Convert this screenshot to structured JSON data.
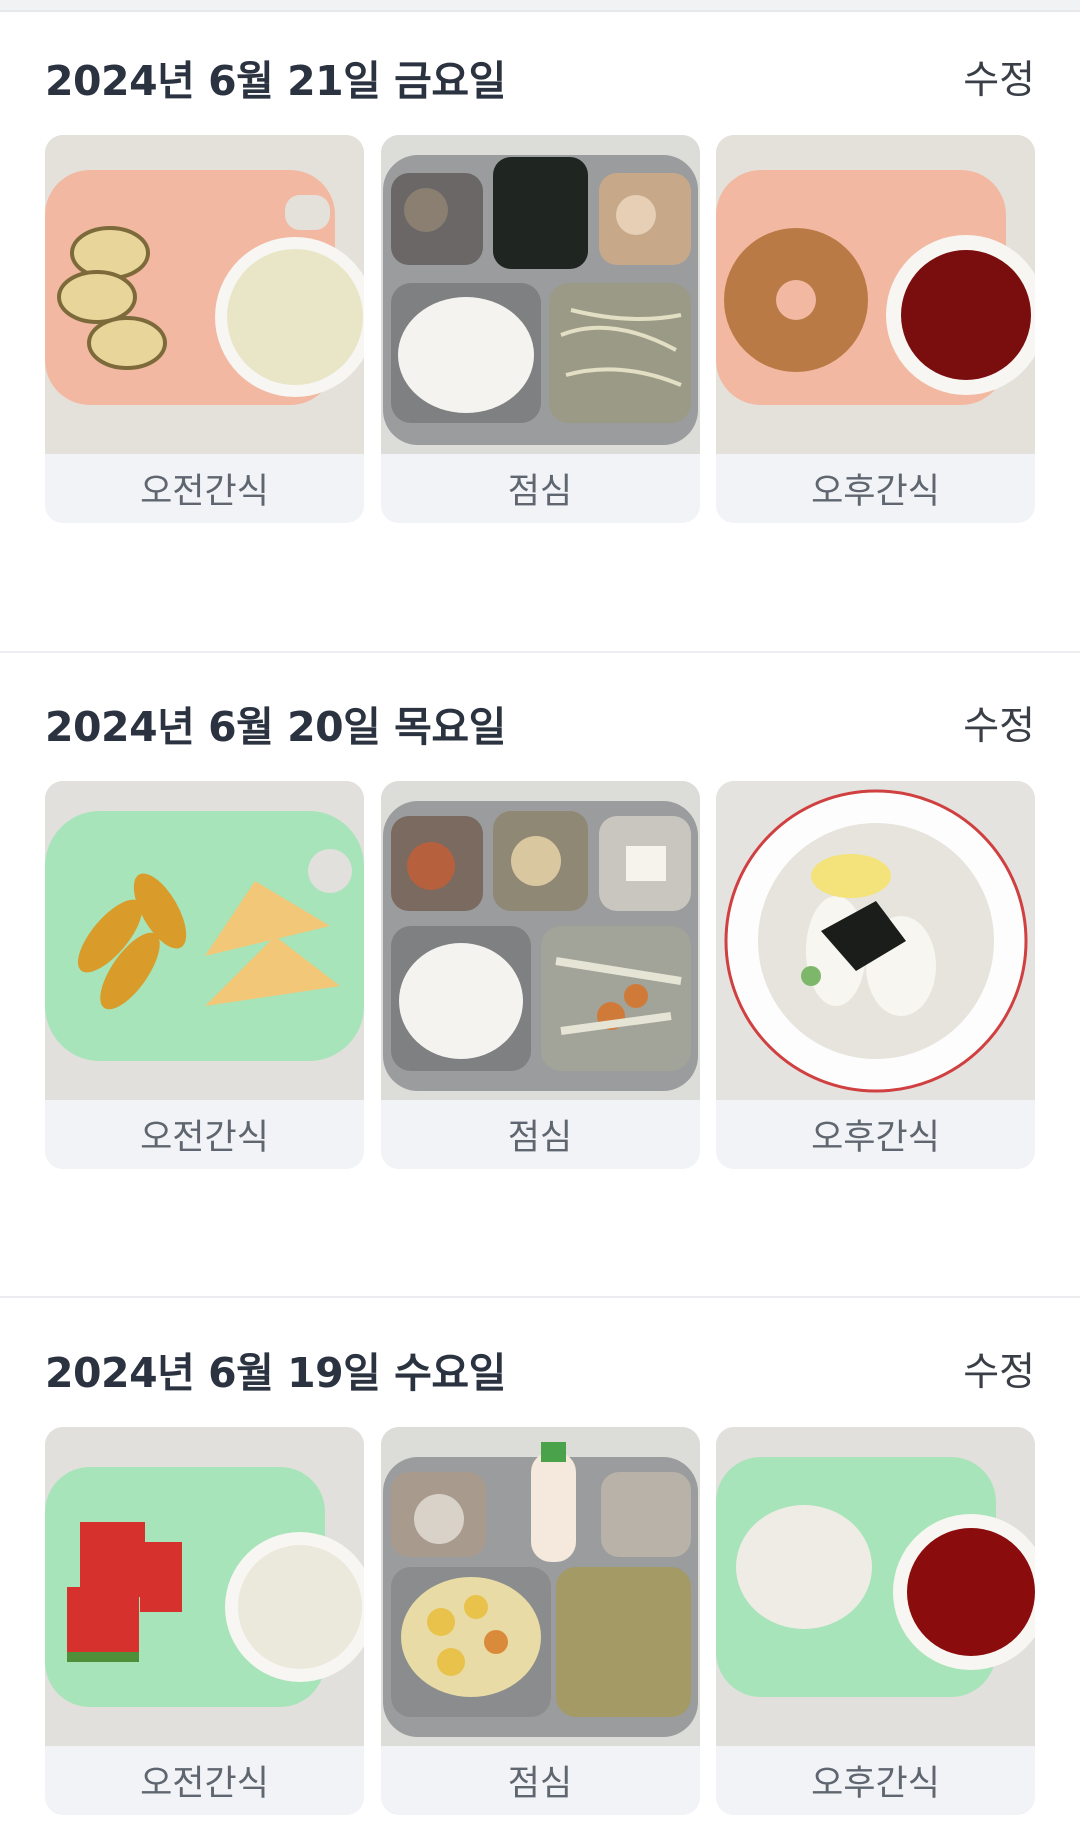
{
  "days": [
    {
      "date_label": "2024년 6월 21일 금요일",
      "edit_label": "수정",
      "meals": [
        {
          "label": "오전간식",
          "photo": "banana-and-milk-photo"
        },
        {
          "label": "점심",
          "photo": "rice-seaweed-bean-sprout-lunch-photo"
        },
        {
          "label": "오후간식",
          "photo": "donut-and-juice-photo"
        }
      ]
    },
    {
      "date_label": "2024년 6월 20일 목요일",
      "edit_label": "수정",
      "meals": [
        {
          "label": "오전간식",
          "photo": "peach-and-cheese-photo"
        },
        {
          "label": "점심",
          "photo": "rice-shrimp-radish-lunch-photo"
        },
        {
          "label": "오후간식",
          "photo": "rice-cake-soup-photo"
        }
      ]
    },
    {
      "date_label": "2024년 6월 19일 수요일",
      "edit_label": "수정",
      "meals": [
        {
          "label": "오전간식",
          "photo": "watermelon-and-milk-photo"
        },
        {
          "label": "점심",
          "photo": "curry-rice-yogurt-lunch-photo"
        },
        {
          "label": "오후간식",
          "photo": "steamed-bun-and-juice-photo"
        }
      ]
    }
  ],
  "colors": {
    "title": "#2b3240",
    "label_bg": "#f1f3f6",
    "label_text": "#5f6670",
    "divider": "#ebedf0"
  }
}
